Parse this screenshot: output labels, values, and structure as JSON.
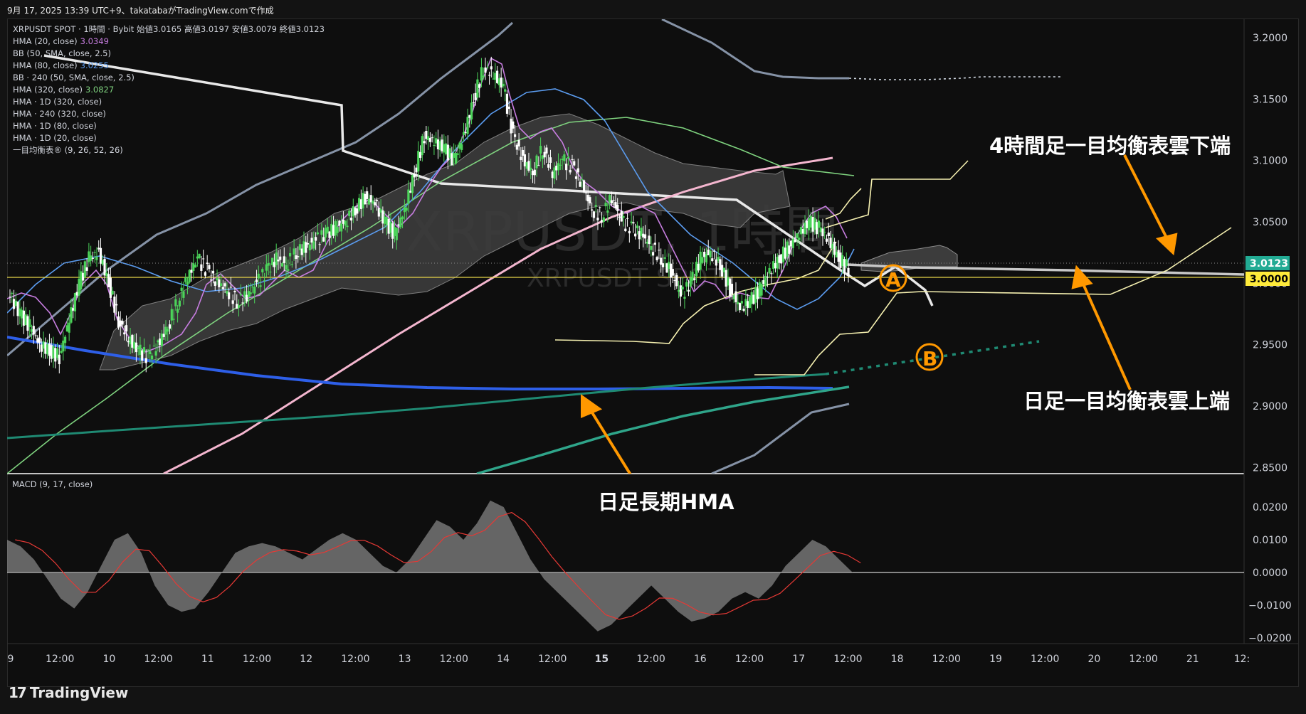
{
  "header": "9月 17, 2025 13:39 UTC+9、takatabaがTradingView.comで作成",
  "legend": [
    {
      "label": "XRPUSDT SPOT · 1時間 · Bybit  始値3.0165  高値3.0197  安値3.0079  終値3.0123",
      "value": "",
      "color": "#d1d4dc"
    },
    {
      "label": "HMA (20, close)",
      "value": "3.0349",
      "color": "#c77de0"
    },
    {
      "label": "BB (50, SMA, close, 2.5)",
      "value": "",
      "color": "#d1d4dc"
    },
    {
      "label": "HMA (80, close)",
      "value": "3.0255",
      "color": "#5b9cf0"
    },
    {
      "label": "BB · 240 (50, SMA, close, 2.5)",
      "value": "",
      "color": "#d1d4dc"
    },
    {
      "label": "HMA (320, close)",
      "value": "3.0827",
      "color": "#7fd37f"
    },
    {
      "label": "HMA · 1D (320, close)",
      "value": "",
      "color": "#d1d4dc"
    },
    {
      "label": "HMA · 240 (320, close)",
      "value": "",
      "color": "#d1d4dc"
    },
    {
      "label": "HMA · 1D (80, close)",
      "value": "",
      "color": "#d1d4dc"
    },
    {
      "label": "HMA · 1D (20, close)",
      "value": "",
      "color": "#d1d4dc"
    },
    {
      "label": "一目均衡表® (9, 26, 52, 26)",
      "value": "",
      "color": "#d1d4dc"
    }
  ],
  "watermark": {
    "main": "XRPUSDT, 1時間",
    "sub": "XRPUSDT SPOT"
  },
  "macd_label": "MACD (9, 17, close)",
  "price_labels": {
    "last": "3.0123",
    "level": "3.0000"
  },
  "annotations": {
    "h4_cloud_lower": "4時間足一目均衡表雲下端",
    "daily_cloud_upper": "日足一目均衡表雲上端",
    "daily_long_hma": "日足長期HMA",
    "point_a": "A",
    "point_b": "B"
  },
  "brand": "TradingView",
  "colors": {
    "bull": "#4cd45a",
    "bear": "#ffffff",
    "hma20": "#c77de0",
    "hma80": "#5b9cf0",
    "hma320": "#7fd37f",
    "pink": "#f4b6cf",
    "blue_hma": "#2e5fe8",
    "teal": "#1f8a73",
    "teal2": "#2fa58a",
    "bb": "#8592a6",
    "cloud": "#5a5a5a",
    "yellow": "#f5f0b0",
    "orange": "#ff9800",
    "level": "#e8d64a",
    "last_bg": "#22ab94",
    "level_bg": "#ffeb3b"
  },
  "chart_data": [
    {
      "type": "line",
      "title": "XRPUSDT SPOT · 1時間 · Bybit",
      "x_tick_labels": [
        "9",
        "12:00",
        "10",
        "12:00",
        "11",
        "12:00",
        "12",
        "12:00",
        "13",
        "12:00",
        "14",
        "12:00",
        "15",
        "12:00",
        "16",
        "12:00",
        "17",
        "12:00",
        "18",
        "12:00",
        "19",
        "12:00",
        "20",
        "12:00",
        "21",
        "12:"
      ],
      "y_tick_labels": [
        "3.2000",
        "3.1500",
        "3.1000",
        "3.0500",
        "3.0000",
        "2.9500",
        "2.9000",
        "2.8500"
      ],
      "ylim": [
        2.845,
        3.215
      ],
      "series": [
        {
          "name": "Close",
          "values": [
            2.99,
            2.975,
            2.965,
            2.95,
            2.945,
            2.94,
            2.97,
            3.0,
            3.02,
            3.025,
            3.0,
            2.97,
            2.955,
            2.945,
            2.94,
            2.95,
            2.965,
            2.985,
            3.005,
            3.02,
            3.01,
            3.0,
            2.995,
            2.985,
            2.99,
            3.0,
            3.01,
            3.02,
            3.015,
            3.025,
            3.03,
            3.035,
            3.04,
            3.045,
            3.05,
            3.06,
            3.07,
            3.065,
            3.05,
            3.04,
            3.06,
            3.09,
            3.12,
            3.115,
            3.11,
            3.1,
            3.12,
            3.15,
            3.175,
            3.17,
            3.16,
            3.12,
            3.1,
            3.09,
            3.11,
            3.09,
            3.1,
            3.095,
            3.08,
            3.06,
            3.055,
            3.07,
            3.05,
            3.045,
            3.04,
            3.03,
            3.02,
            3.01,
            2.99,
            3.0,
            3.02,
            3.025,
            3.015,
            2.995,
            2.98,
            2.985,
            2.995,
            3.01,
            3.02,
            3.03,
            3.04,
            3.05,
            3.045,
            3.035,
            3.02,
            3.012
          ]
        },
        {
          "name": "",
          "values": [
            0.01,
            0.008,
            0.004,
            -0.002,
            -0.008,
            -0.011,
            -0.006,
            0.002,
            0.01,
            0.012,
            0.006,
            -0.004,
            -0.01,
            -0.012,
            -0.011,
            -0.006,
            0.0,
            0.006,
            0.008,
            0.009,
            0.008,
            0.006,
            0.004,
            0.007,
            0.01,
            0.012,
            0.01,
            0.006,
            0.002,
            0.0,
            0.004,
            0.01,
            0.016,
            0.014,
            0.01,
            0.015,
            0.022,
            0.02,
            0.012,
            0.004,
            -0.002,
            -0.006,
            -0.01,
            -0.014,
            -0.018,
            -0.016,
            -0.012,
            -0.008,
            -0.004,
            -0.008,
            -0.012,
            -0.015,
            -0.014,
            -0.012,
            -0.008,
            -0.006,
            -0.008,
            -0.004,
            0.002,
            0.006,
            0.01,
            0.008,
            0.004,
            0.0
          ]
        }
      ]
    }
  ]
}
